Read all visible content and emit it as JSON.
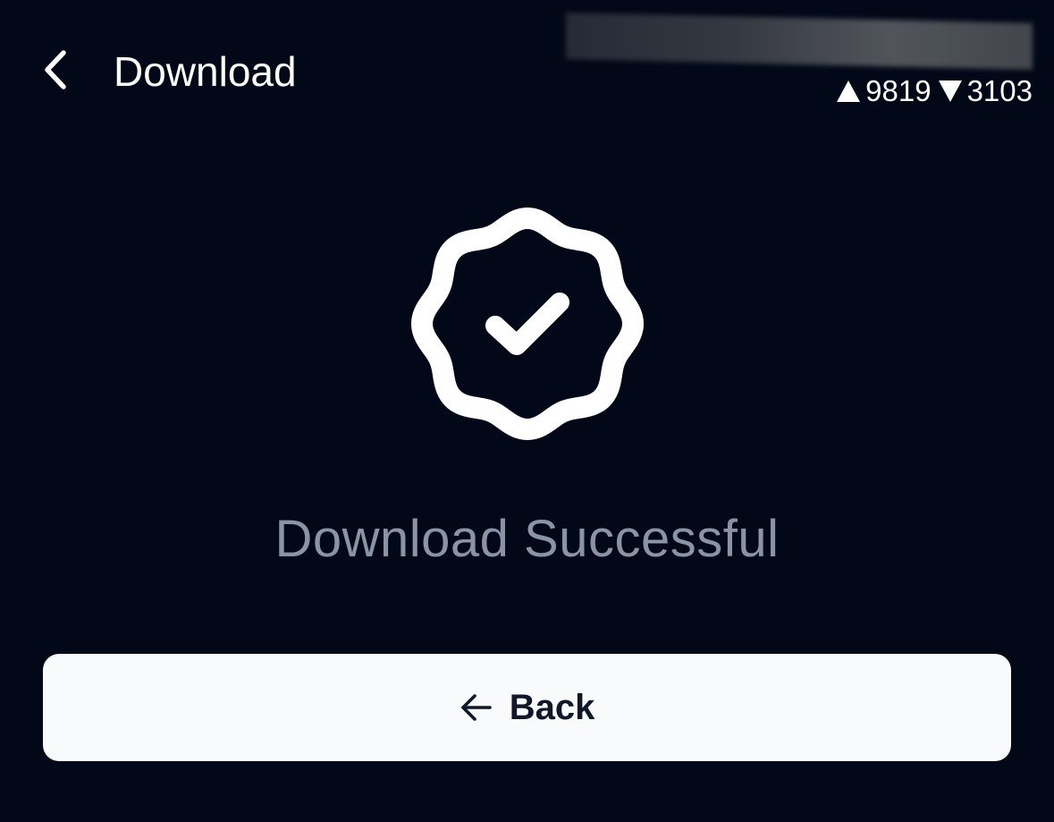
{
  "header": {
    "title": "Download",
    "back_icon": "chevron-left-icon"
  },
  "stats": {
    "up_icon": "triangle-up-icon",
    "up_value": "9819",
    "down_icon": "triangle-down-icon",
    "down_value": "3103"
  },
  "main": {
    "badge_icon": "badge-check-icon",
    "status_text": "Download Successful"
  },
  "actions": {
    "back_label": "Back",
    "back_icon": "arrow-left-icon"
  },
  "colors": {
    "background": "#020817",
    "foreground": "#ffffff",
    "muted_text": "#8a94a6",
    "button_bg": "#f8fafc",
    "button_text": "#0f172a"
  }
}
